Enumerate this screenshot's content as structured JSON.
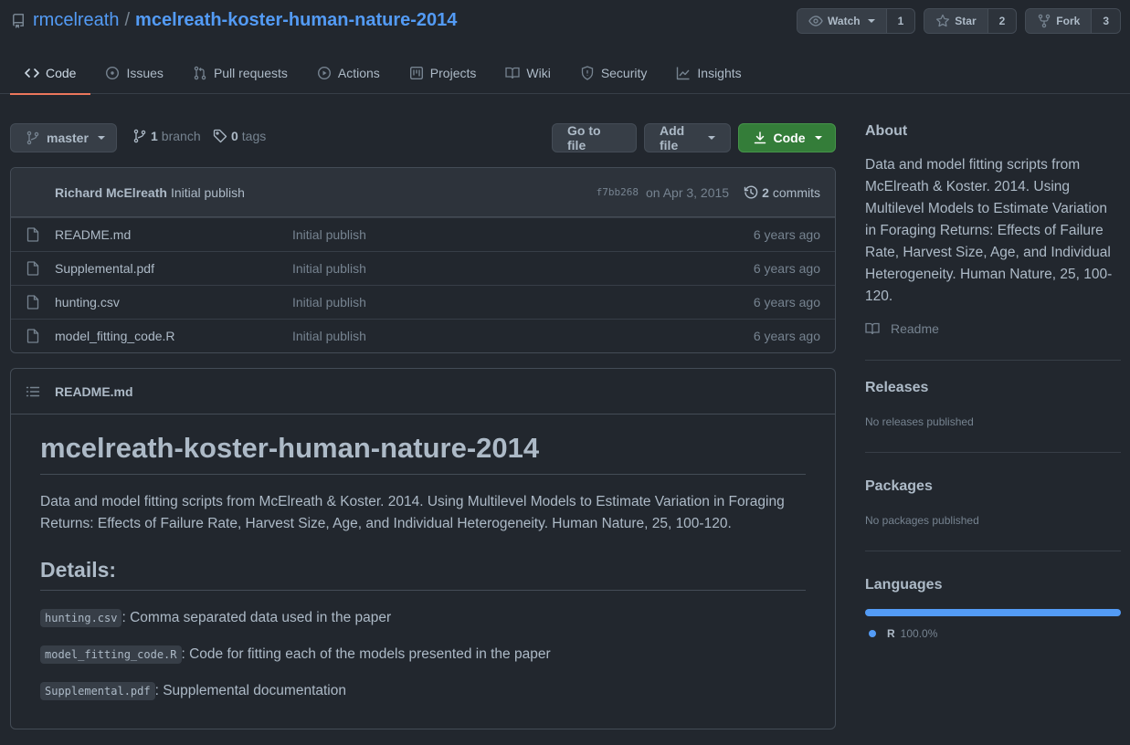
{
  "repo": {
    "owner": "rmcelreath",
    "separator": "/",
    "name": "mcelreath-koster-human-nature-2014"
  },
  "header_actions": {
    "watch": {
      "label": "Watch",
      "count": "1"
    },
    "star": {
      "label": "Star",
      "count": "2"
    },
    "fork": {
      "label": "Fork",
      "count": "3"
    }
  },
  "tabs": [
    {
      "label": "Code",
      "icon": "code-icon"
    },
    {
      "label": "Issues",
      "icon": "issue-icon"
    },
    {
      "label": "Pull requests",
      "icon": "pull-request-icon"
    },
    {
      "label": "Actions",
      "icon": "play-icon"
    },
    {
      "label": "Projects",
      "icon": "project-icon"
    },
    {
      "label": "Wiki",
      "icon": "book-icon"
    },
    {
      "label": "Security",
      "icon": "shield-icon"
    },
    {
      "label": "Insights",
      "icon": "graph-icon"
    }
  ],
  "toolbar": {
    "branch": "master",
    "branch_count": "1",
    "branch_label": "branch",
    "tag_count": "0",
    "tag_label": "tags",
    "goto_file": "Go to file",
    "add_file": "Add file",
    "code": "Code"
  },
  "commit": {
    "author": "Richard McElreath",
    "message": "Initial publish",
    "sha": "f7bb268",
    "date": "on Apr 3, 2015",
    "commit_count": "2",
    "commit_label": "commits"
  },
  "files": [
    {
      "name": "README.md",
      "message": "Initial publish",
      "age": "6 years ago"
    },
    {
      "name": "Supplemental.pdf",
      "message": "Initial publish",
      "age": "6 years ago"
    },
    {
      "name": "hunting.csv",
      "message": "Initial publish",
      "age": "6 years ago"
    },
    {
      "name": "model_fitting_code.R",
      "message": "Initial publish",
      "age": "6 years ago"
    }
  ],
  "readme": {
    "file_title": "README.md",
    "h1": "mcelreath-koster-human-nature-2014",
    "paragraph": "Data and model fitting scripts from McElreath & Koster. 2014. Using Multilevel Models to Estimate Variation in Foraging Returns: Effects of Failure Rate, Harvest Size, Age, and Individual Heterogeneity. Human Nature, 25, 100-120.",
    "h2": "Details:",
    "details": [
      {
        "code": "hunting.csv",
        "text": ": Comma separated data used in the paper"
      },
      {
        "code": "model_fitting_code.R",
        "text": ": Code for fitting each of the models presented in the paper"
      },
      {
        "code": "Supplemental.pdf",
        "text": ": Supplemental documentation"
      }
    ]
  },
  "sidebar": {
    "about_title": "About",
    "about_desc": "Data and model fitting scripts from McElreath & Koster. 2014. Using Multilevel Models to Estimate Variation in Foraging Returns: Effects of Failure Rate, Harvest Size, Age, and Individual Heterogeneity. Human Nature, 25, 100-120.",
    "readme_link": "Readme",
    "releases_title": "Releases",
    "releases_note": "No releases published",
    "packages_title": "Packages",
    "packages_note": "No packages published",
    "languages_title": "Languages",
    "languages": [
      {
        "name": "R",
        "percent": "100.0%",
        "fraction": 1.0,
        "color": "#539bf5"
      }
    ]
  },
  "colors": {
    "background": "#22272e",
    "accent_link": "#539bf5",
    "active_tab_underline": "#ec775c",
    "code_button": "#347d39"
  }
}
